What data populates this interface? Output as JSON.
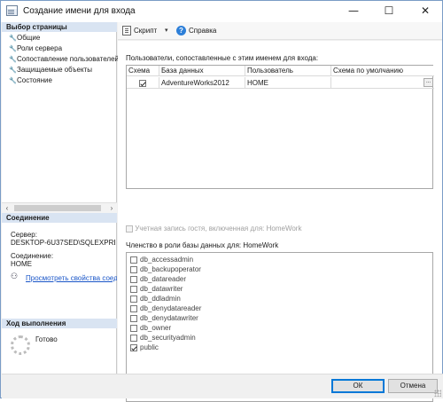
{
  "window": {
    "title": "Создание имени для входа",
    "minimize_glyph": "—",
    "maximize_glyph": "☐",
    "close_glyph": "✕"
  },
  "sidebar": {
    "select_page_header": "Выбор страницы",
    "pages": [
      {
        "label": "Общие"
      },
      {
        "label": "Роли сервера"
      },
      {
        "label": "Сопоставление пользователей"
      },
      {
        "label": "Защищаемые объекты"
      },
      {
        "label": "Состояние"
      }
    ],
    "connection_header": "Соединение",
    "server_label": "Сервер:",
    "server_value": "DESKTOP-6U37SED\\SQLEXPRESS",
    "connection_label": "Соединение:",
    "connection_value": "HOME",
    "view_props_link": "Просмотреть свойства соединения",
    "progress_header": "Ход выполнения",
    "progress_status": "Готово"
  },
  "toolbar": {
    "script_label": "Скрипт",
    "help_label": "Справка"
  },
  "main": {
    "mapped_users_label": "Пользователи, сопоставленные с этим именем для входа:",
    "columns": [
      "Схема",
      "База данных",
      "Пользователь",
      "Схема по умолчанию"
    ],
    "rows": [
      {
        "mapped": true,
        "database": "AdventureWorks2012",
        "user": "HOME",
        "default_schema": ""
      }
    ],
    "ellipsis": "...",
    "guest_account_label": "Учетная запись гостя, включенная для: HomeWork",
    "role_membership_label": "Членство в роли базы данных для: HomeWork",
    "roles": [
      {
        "name": "db_accessadmin",
        "checked": false
      },
      {
        "name": "db_backupoperator",
        "checked": false
      },
      {
        "name": "db_datareader",
        "checked": false
      },
      {
        "name": "db_datawriter",
        "checked": false
      },
      {
        "name": "db_ddladmin",
        "checked": false
      },
      {
        "name": "db_denydatareader",
        "checked": false
      },
      {
        "name": "db_denydatawriter",
        "checked": false
      },
      {
        "name": "db_owner",
        "checked": false
      },
      {
        "name": "db_securityadmin",
        "checked": false
      },
      {
        "name": "public",
        "checked": true
      }
    ]
  },
  "footer": {
    "ok_label": "ОК",
    "cancel_label": "Отмена"
  }
}
